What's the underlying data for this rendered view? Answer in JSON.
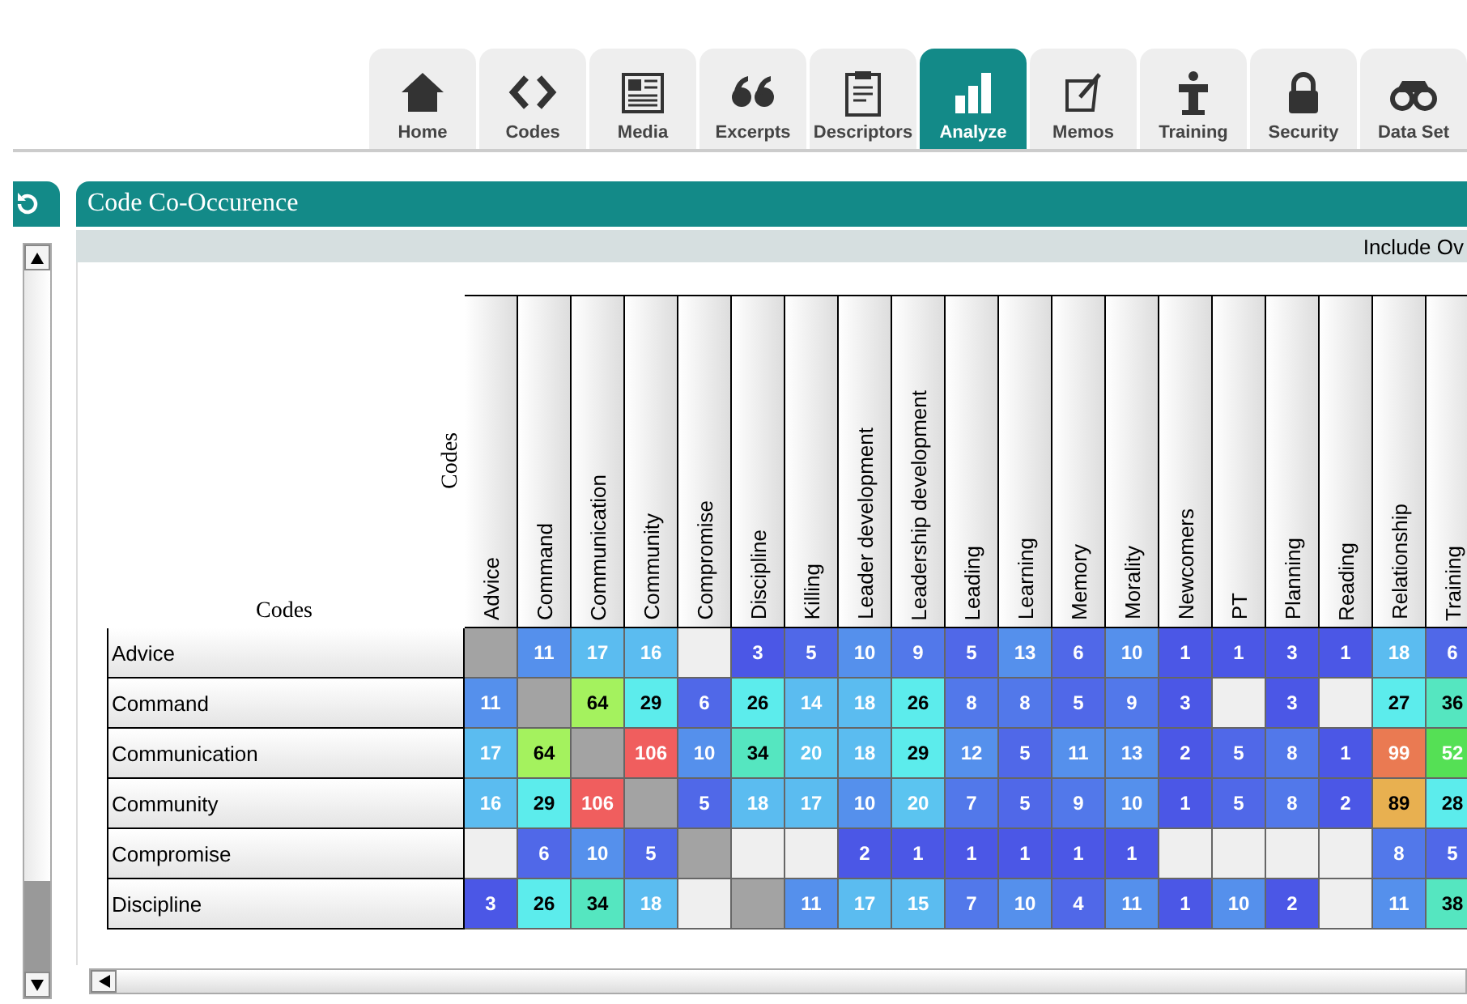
{
  "tabs": [
    {
      "label": "Home",
      "selected": false
    },
    {
      "label": "Codes",
      "selected": false
    },
    {
      "label": "Media",
      "selected": false
    },
    {
      "label": "Excerpts",
      "selected": false
    },
    {
      "label": "Descriptors",
      "selected": false
    },
    {
      "label": "Analyze",
      "selected": true
    },
    {
      "label": "Memos",
      "selected": false
    },
    {
      "label": "Training",
      "selected": false
    },
    {
      "label": "Security",
      "selected": false
    },
    {
      "label": "Data Set",
      "selected": false
    }
  ],
  "panel": {
    "title": "Code Co-Occurence",
    "toolbar_text": "Include Ov"
  },
  "matrix": {
    "row_axis_label": "Codes",
    "column_axis_label": "Codes",
    "columns": [
      "Advice",
      "Command",
      "Communication",
      "Community",
      "Compromise",
      "Discipline",
      "Killing",
      "Leader development",
      "Leadership development",
      "Leading",
      "Learning",
      "Memory",
      "Morality",
      "Newcomers",
      "PT",
      "Planning",
      "Reading",
      "Relationship",
      "Training"
    ],
    "rows": [
      {
        "label": "Advice",
        "cells": [
          {
            "kind": "self",
            "color": "#a3a3a3"
          },
          {
            "kind": "count",
            "value": "11",
            "color": "#5590ec"
          },
          {
            "kind": "count",
            "value": "17",
            "color": "#5bbcf0"
          },
          {
            "kind": "count",
            "value": "16",
            "color": "#5bbcf0"
          },
          {
            "kind": "none",
            "color": "#efefef"
          },
          {
            "kind": "count",
            "value": "3",
            "color": "#4b57e6"
          },
          {
            "kind": "count",
            "value": "5",
            "color": "#5068e8"
          },
          {
            "kind": "count",
            "value": "10",
            "color": "#5590ec"
          },
          {
            "kind": "count",
            "value": "9",
            "color": "#5278ea"
          },
          {
            "kind": "count",
            "value": "5",
            "color": "#5068e8"
          },
          {
            "kind": "count",
            "value": "13",
            "color": "#5590ec"
          },
          {
            "kind": "count",
            "value": "6",
            "color": "#5068e8"
          },
          {
            "kind": "count",
            "value": "10",
            "color": "#5590ec"
          },
          {
            "kind": "count",
            "value": "1",
            "color": "#4b57e6"
          },
          {
            "kind": "count",
            "value": "1",
            "color": "#4b57e6"
          },
          {
            "kind": "count",
            "value": "3",
            "color": "#4b57e6"
          },
          {
            "kind": "count",
            "value": "1",
            "color": "#4b57e6"
          },
          {
            "kind": "count",
            "value": "18",
            "color": "#5bbcf0"
          },
          {
            "kind": "count",
            "value": "6",
            "color": "#5068e8"
          }
        ]
      },
      {
        "label": "Command",
        "cells": [
          {
            "kind": "count",
            "value": "11",
            "color": "#5590ec"
          },
          {
            "kind": "self",
            "color": "#a3a3a3"
          },
          {
            "kind": "count",
            "value": "64",
            "color": "#a4f25e"
          },
          {
            "kind": "count",
            "value": "29",
            "color": "#5cecec"
          },
          {
            "kind": "count",
            "value": "6",
            "color": "#5068e8"
          },
          {
            "kind": "count",
            "value": "26",
            "color": "#5cecec"
          },
          {
            "kind": "count",
            "value": "14",
            "color": "#5bbcf0"
          },
          {
            "kind": "count",
            "value": "18",
            "color": "#5bbcf0"
          },
          {
            "kind": "count",
            "value": "26",
            "color": "#5cecec"
          },
          {
            "kind": "count",
            "value": "8",
            "color": "#5278ea"
          },
          {
            "kind": "count",
            "value": "8",
            "color": "#5278ea"
          },
          {
            "kind": "count",
            "value": "5",
            "color": "#5068e8"
          },
          {
            "kind": "count",
            "value": "9",
            "color": "#5278ea"
          },
          {
            "kind": "count",
            "value": "3",
            "color": "#4b57e6"
          },
          {
            "kind": "none",
            "color": "#efefef"
          },
          {
            "kind": "count",
            "value": "3",
            "color": "#4b57e6"
          },
          {
            "kind": "none",
            "color": "#efefef"
          },
          {
            "kind": "count",
            "value": "27",
            "color": "#5cecec"
          },
          {
            "kind": "count",
            "value": "36",
            "color": "#55e6c0"
          }
        ]
      },
      {
        "label": "Communication",
        "cells": [
          {
            "kind": "count",
            "value": "17",
            "color": "#5bbcf0"
          },
          {
            "kind": "count",
            "value": "64",
            "color": "#a4f25e"
          },
          {
            "kind": "self",
            "color": "#a3a3a3"
          },
          {
            "kind": "count",
            "value": "106",
            "color": "#f05e5e"
          },
          {
            "kind": "count",
            "value": "10",
            "color": "#5590ec"
          },
          {
            "kind": "count",
            "value": "34",
            "color": "#55e6c0"
          },
          {
            "kind": "count",
            "value": "20",
            "color": "#5bc4f0"
          },
          {
            "kind": "count",
            "value": "18",
            "color": "#5bbcf0"
          },
          {
            "kind": "count",
            "value": "29",
            "color": "#5cecec"
          },
          {
            "kind": "count",
            "value": "12",
            "color": "#5590ec"
          },
          {
            "kind": "count",
            "value": "5",
            "color": "#5068e8"
          },
          {
            "kind": "count",
            "value": "11",
            "color": "#5590ec"
          },
          {
            "kind": "count",
            "value": "13",
            "color": "#5590ec"
          },
          {
            "kind": "count",
            "value": "2",
            "color": "#4b57e6"
          },
          {
            "kind": "count",
            "value": "5",
            "color": "#5068e8"
          },
          {
            "kind": "count",
            "value": "8",
            "color": "#5278ea"
          },
          {
            "kind": "count",
            "value": "1",
            "color": "#4b57e6"
          },
          {
            "kind": "count",
            "value": "99",
            "color": "#ea7a52"
          },
          {
            "kind": "count",
            "value": "52",
            "color": "#55e055"
          }
        ]
      },
      {
        "label": "Community",
        "cells": [
          {
            "kind": "count",
            "value": "16",
            "color": "#5bbcf0"
          },
          {
            "kind": "count",
            "value": "29",
            "color": "#5cecec"
          },
          {
            "kind": "count",
            "value": "106",
            "color": "#f05e5e"
          },
          {
            "kind": "self",
            "color": "#a3a3a3"
          },
          {
            "kind": "count",
            "value": "5",
            "color": "#5068e8"
          },
          {
            "kind": "count",
            "value": "18",
            "color": "#5bbcf0"
          },
          {
            "kind": "count",
            "value": "17",
            "color": "#5bbcf0"
          },
          {
            "kind": "count",
            "value": "10",
            "color": "#5590ec"
          },
          {
            "kind": "count",
            "value": "20",
            "color": "#5bc4f0"
          },
          {
            "kind": "count",
            "value": "7",
            "color": "#5278ea"
          },
          {
            "kind": "count",
            "value": "5",
            "color": "#5068e8"
          },
          {
            "kind": "count",
            "value": "9",
            "color": "#5278ea"
          },
          {
            "kind": "count",
            "value": "10",
            "color": "#5590ec"
          },
          {
            "kind": "count",
            "value": "1",
            "color": "#4b57e6"
          },
          {
            "kind": "count",
            "value": "5",
            "color": "#5068e8"
          },
          {
            "kind": "count",
            "value": "8",
            "color": "#5278ea"
          },
          {
            "kind": "count",
            "value": "2",
            "color": "#4b57e6"
          },
          {
            "kind": "count",
            "value": "89",
            "color": "#e8b050"
          },
          {
            "kind": "count",
            "value": "28",
            "color": "#5cecec"
          }
        ]
      },
      {
        "label": "Compromise",
        "cells": [
          {
            "kind": "none",
            "color": "#efefef"
          },
          {
            "kind": "count",
            "value": "6",
            "color": "#5068e8"
          },
          {
            "kind": "count",
            "value": "10",
            "color": "#5590ec"
          },
          {
            "kind": "count",
            "value": "5",
            "color": "#5068e8"
          },
          {
            "kind": "self",
            "color": "#a3a3a3"
          },
          {
            "kind": "none",
            "color": "#efefef"
          },
          {
            "kind": "none",
            "color": "#efefef"
          },
          {
            "kind": "count",
            "value": "2",
            "color": "#4b57e6"
          },
          {
            "kind": "count",
            "value": "1",
            "color": "#4b57e6"
          },
          {
            "kind": "count",
            "value": "1",
            "color": "#4b57e6"
          },
          {
            "kind": "count",
            "value": "1",
            "color": "#4b57e6"
          },
          {
            "kind": "count",
            "value": "1",
            "color": "#4b57e6"
          },
          {
            "kind": "count",
            "value": "1",
            "color": "#4b57e6"
          },
          {
            "kind": "none",
            "color": "#efefef"
          },
          {
            "kind": "none",
            "color": "#efefef"
          },
          {
            "kind": "none",
            "color": "#efefef"
          },
          {
            "kind": "none",
            "color": "#efefef"
          },
          {
            "kind": "count",
            "value": "8",
            "color": "#5278ea"
          },
          {
            "kind": "count",
            "value": "5",
            "color": "#5068e8"
          }
        ]
      },
      {
        "label": "Discipline",
        "cells": [
          {
            "kind": "count",
            "value": "3",
            "color": "#4b57e6"
          },
          {
            "kind": "count",
            "value": "26",
            "color": "#5cecec"
          },
          {
            "kind": "count",
            "value": "34",
            "color": "#55e6c0"
          },
          {
            "kind": "count",
            "value": "18",
            "color": "#5bbcf0"
          },
          {
            "kind": "none",
            "color": "#efefef"
          },
          {
            "kind": "self",
            "color": "#a3a3a3"
          },
          {
            "kind": "count",
            "value": "11",
            "color": "#5590ec"
          },
          {
            "kind": "count",
            "value": "17",
            "color": "#5bbcf0"
          },
          {
            "kind": "count",
            "value": "15",
            "color": "#5bbcf0"
          },
          {
            "kind": "count",
            "value": "7",
            "color": "#5278ea"
          },
          {
            "kind": "count",
            "value": "10",
            "color": "#5590ec"
          },
          {
            "kind": "count",
            "value": "4",
            "color": "#5068e8"
          },
          {
            "kind": "count",
            "value": "11",
            "color": "#5590ec"
          },
          {
            "kind": "count",
            "value": "1",
            "color": "#4b57e6"
          },
          {
            "kind": "count",
            "value": "10",
            "color": "#5590ec"
          },
          {
            "kind": "count",
            "value": "2",
            "color": "#4b57e6"
          },
          {
            "kind": "none",
            "color": "#efefef"
          },
          {
            "kind": "count",
            "value": "11",
            "color": "#5590ec"
          },
          {
            "kind": "count",
            "value": "38",
            "color": "#55e6c0"
          }
        ]
      }
    ]
  }
}
